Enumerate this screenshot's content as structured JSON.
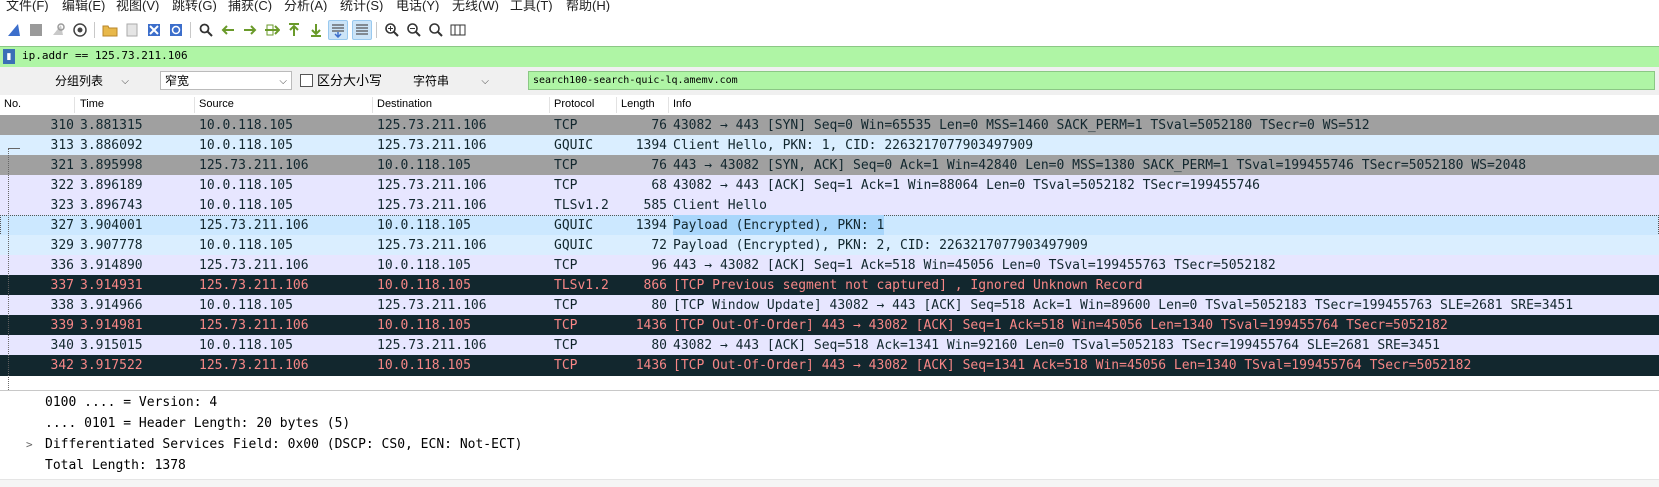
{
  "menu": [
    "文件(F)",
    "编辑(E)",
    "视图(V)",
    "跳转(G)",
    "捕获(C)",
    "分析(A)",
    "统计(S)",
    "电话(Y)",
    "无线(W)",
    "工具(T)",
    "帮助(H)"
  ],
  "toolbar_icons": [
    "shark-fin-start-icon",
    "stop-icon",
    "restart-icon",
    "capture-options-icon",
    "open-folder-icon",
    "file-icon",
    "close-file-icon",
    "reload-icon",
    "find-icon",
    "go-back-icon",
    "go-forward-icon",
    "go-to-packet-icon",
    "go-first-icon",
    "go-last-icon",
    "autoscroll-icon",
    "colorize-icon",
    "zoom-in-icon",
    "zoom-out-icon",
    "zoom-normal-icon",
    "resize-columns-icon"
  ],
  "filter": {
    "value": "ip.addr == 125.73.211.106"
  },
  "find": {
    "search_in": "分组列表",
    "charset": "窄宽",
    "case_label": "区分大小写",
    "search_type": "字符串",
    "value": "search100-search-quic-lq.amemv.com"
  },
  "columns": [
    "No.",
    "Time",
    "Source",
    "Destination",
    "Protocol",
    "Length",
    "Info"
  ],
  "packets": [
    {
      "no": "310",
      "time": "3.881315",
      "src": "10.0.118.105",
      "dst": "125.73.211.106",
      "proto": "TCP",
      "len": "76",
      "info": "43082 → 443 [SYN] Seq=0 Win=65535 Len=0 MSS=1460 SACK_PERM=1 TSval=5052180 TSecr=0 WS=512",
      "style": "r-gray"
    },
    {
      "no": "313",
      "time": "3.886092",
      "src": "10.0.118.105",
      "dst": "125.73.211.106",
      "proto": "GQUIC",
      "len": "1394",
      "info": "Client Hello, PKN: 1, CID: 2263217077903497909",
      "style": "r-ltblue"
    },
    {
      "no": "321",
      "time": "3.895998",
      "src": "125.73.211.106",
      "dst": "10.0.118.105",
      "proto": "TCP",
      "len": "76",
      "info": "443 → 43082 [SYN, ACK] Seq=0 Ack=1 Win=42840 Len=0 MSS=1380 SACK_PERM=1 TSval=199455746 TSecr=5052180 WS=2048",
      "style": "r-gray"
    },
    {
      "no": "322",
      "time": "3.896189",
      "src": "10.0.118.105",
      "dst": "125.73.211.106",
      "proto": "TCP",
      "len": "68",
      "info": "43082 → 443 [ACK] Seq=1 Ack=1 Win=88064 Len=0 TSval=5052182 TSecr=199455746",
      "style": "r-lav"
    },
    {
      "no": "323",
      "time": "3.896743",
      "src": "10.0.118.105",
      "dst": "125.73.211.106",
      "proto": "TLSv1.2",
      "len": "585",
      "info": "Client Hello",
      "style": "r-lav"
    },
    {
      "no": "327",
      "time": "3.904001",
      "src": "125.73.211.106",
      "dst": "10.0.118.105",
      "proto": "GQUIC",
      "len": "1394",
      "info": "Payload (Encrypted), PKN: 1",
      "style": "r-sel"
    },
    {
      "no": "329",
      "time": "3.907778",
      "src": "10.0.118.105",
      "dst": "125.73.211.106",
      "proto": "GQUIC",
      "len": "72",
      "info": "Payload (Encrypted), PKN: 2, CID: 2263217077903497909",
      "style": "r-ltblue"
    },
    {
      "no": "336",
      "time": "3.914890",
      "src": "125.73.211.106",
      "dst": "10.0.118.105",
      "proto": "TCP",
      "len": "96",
      "info": "443 → 43082 [ACK] Seq=1 Ack=518 Win=45056 Len=0 TSval=199455763 TSecr=5052182",
      "style": "r-lav"
    },
    {
      "no": "337",
      "time": "3.914931",
      "src": "125.73.211.106",
      "dst": "10.0.118.105",
      "proto": "TLSv1.2",
      "len": "866",
      "info": "[TCP Previous segment not captured] , Ignored Unknown Record",
      "style": "r-dark"
    },
    {
      "no": "338",
      "time": "3.914966",
      "src": "10.0.118.105",
      "dst": "125.73.211.106",
      "proto": "TCP",
      "len": "80",
      "info": "[TCP Window Update] 43082 → 443 [ACK] Seq=518 Ack=1 Win=89600 Len=0 TSval=5052183 TSecr=199455763 SLE=2681 SRE=3451",
      "style": "r-lav"
    },
    {
      "no": "339",
      "time": "3.914981",
      "src": "125.73.211.106",
      "dst": "10.0.118.105",
      "proto": "TCP",
      "len": "1436",
      "info": "[TCP Out-Of-Order] 443 → 43082 [ACK] Seq=1 Ack=518 Win=45056 Len=1340 TSval=199455764 TSecr=5052182",
      "style": "r-dark"
    },
    {
      "no": "340",
      "time": "3.915015",
      "src": "10.0.118.105",
      "dst": "125.73.211.106",
      "proto": "TCP",
      "len": "80",
      "info": "43082 → 443 [ACK] Seq=518 Ack=1341 Win=92160 Len=0 TSval=5052183 TSecr=199455764 SLE=2681 SRE=3451",
      "style": "r-lav"
    },
    {
      "no": "342",
      "time": "3.917522",
      "src": "125.73.211.106",
      "dst": "10.0.118.105",
      "proto": "TCP",
      "len": "1436",
      "info": "[TCP Out-Of-Order] 443 → 43082 [ACK] Seq=1341 Ack=518 Win=45056 Len=1340 TSval=199455764 TSecr=5052182",
      "style": "r-dark"
    }
  ],
  "details": [
    {
      "text": "0100 .... = Version: 4",
      "expandable": false
    },
    {
      "text": ".... 0101 = Header Length: 20 bytes (5)",
      "expandable": false
    },
    {
      "text": "Differentiated Services Field: 0x00 (DSCP: CS0, ECN: Not-ECT)",
      "expandable": true
    },
    {
      "text": "Total Length: 1378",
      "expandable": false
    }
  ],
  "colors": {
    "filter_ok_bg": "#aff5a5",
    "row_gray": "#a0a0a0",
    "row_light_blue": "#daeeff",
    "row_lavender": "#e7e6ff",
    "row_dark": "#12272e",
    "row_dark_text": "#f78787",
    "row_selected": "#cce8ff"
  }
}
